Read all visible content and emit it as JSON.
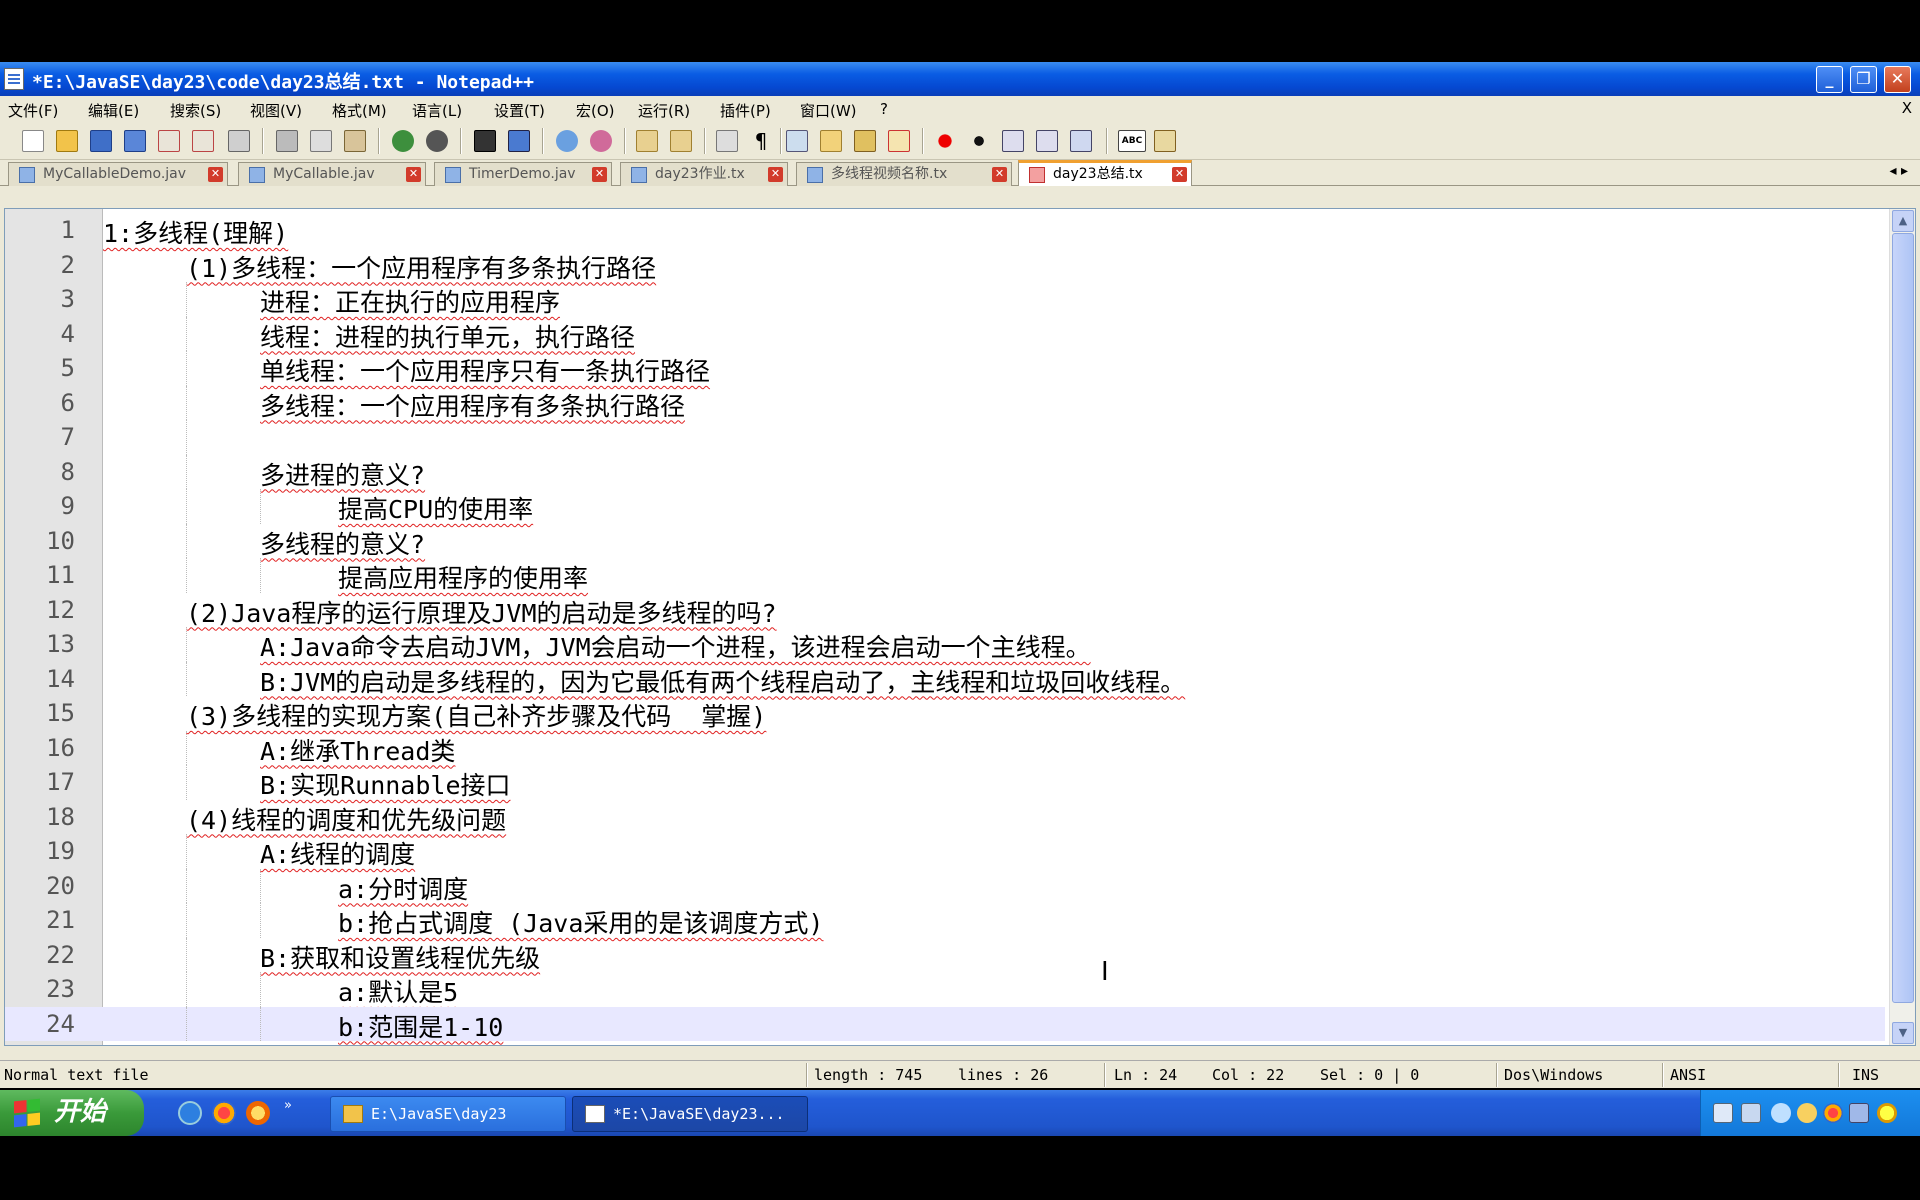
{
  "window": {
    "title": "*E:\\JavaSE\\day23\\code\\day23总结.txt - Notepad++"
  },
  "menu": [
    "文件(F)",
    "编辑(E)",
    "搜索(S)",
    "视图(V)",
    "格式(M)",
    "语言(L)",
    "设置(T)",
    "宏(O)",
    "运行(R)",
    "插件(P)",
    "窗口(W)",
    "?"
  ],
  "menu_close": "X",
  "tabs": [
    {
      "label": "MyCallableDemo.jav",
      "active": false
    },
    {
      "label": "MyCallable.jav",
      "active": false
    },
    {
      "label": "TimerDemo.jav",
      "active": false
    },
    {
      "label": "day23作业.tx",
      "active": false
    },
    {
      "label": "多线程视频名称.tx",
      "active": false
    },
    {
      "label": "day23总结.tx",
      "active": true
    }
  ],
  "tab_arrows": "◂ ▸",
  "editor": {
    "current_line": 24,
    "lines": [
      {
        "n": "1",
        "indent": 0,
        "text": "1:多线程(理解)"
      },
      {
        "n": "2",
        "indent": 1,
        "text": "(1)多线程：一个应用程序有多条执行路径"
      },
      {
        "n": "3",
        "indent": 2,
        "text": "进程：正在执行的应用程序"
      },
      {
        "n": "4",
        "indent": 2,
        "text": "线程：进程的执行单元，执行路径"
      },
      {
        "n": "5",
        "indent": 2,
        "text": "单线程：一个应用程序只有一条执行路径"
      },
      {
        "n": "6",
        "indent": 2,
        "text": "多线程：一个应用程序有多条执行路径"
      },
      {
        "n": "7",
        "indent": 2,
        "text": ""
      },
      {
        "n": "8",
        "indent": 2,
        "text": "多进程的意义?"
      },
      {
        "n": "9",
        "indent": 3,
        "text": "提高CPU的使用率"
      },
      {
        "n": "10",
        "indent": 2,
        "text": "多线程的意义?"
      },
      {
        "n": "11",
        "indent": 3,
        "text": "提高应用程序的使用率"
      },
      {
        "n": "12",
        "indent": 1,
        "text": "(2)Java程序的运行原理及JVM的启动是多线程的吗?"
      },
      {
        "n": "13",
        "indent": 2,
        "text": "A:Java命令去启动JVM，JVM会启动一个进程，该进程会启动一个主线程。"
      },
      {
        "n": "14",
        "indent": 2,
        "text": "B:JVM的启动是多线程的，因为它最低有两个线程启动了，主线程和垃圾回收线程。"
      },
      {
        "n": "15",
        "indent": 1,
        "text": "(3)多线程的实现方案(自己补齐步骤及代码  掌握)"
      },
      {
        "n": "16",
        "indent": 2,
        "text": "A:继承Thread类"
      },
      {
        "n": "17",
        "indent": 2,
        "text": "B:实现Runnable接口"
      },
      {
        "n": "18",
        "indent": 1,
        "text": "(4)线程的调度和优先级问题"
      },
      {
        "n": "19",
        "indent": 2,
        "text": "A:线程的调度"
      },
      {
        "n": "20",
        "indent": 3,
        "text": "a:分时调度"
      },
      {
        "n": "21",
        "indent": 3,
        "text": "b:抢占式调度 (Java采用的是该调度方式)"
      },
      {
        "n": "22",
        "indent": 2,
        "text": "B:获取和设置线程优先级"
      },
      {
        "n": "23",
        "indent": 3,
        "text": "a:默认是5"
      },
      {
        "n": "24",
        "indent": 3,
        "text": "b:范围是1-10"
      }
    ]
  },
  "status": {
    "file_type": "Normal text file",
    "length": "length : 745",
    "lines": "lines : 26",
    "ln": "Ln : 24",
    "col": "Col : 22",
    "sel": "Sel : 0 | 0",
    "eol": "Dos\\Windows",
    "encoding": "ANSI",
    "mode": "INS"
  },
  "taskbar": {
    "start_label": "开始",
    "tasks": [
      {
        "label": "E:\\JavaSE\\day23",
        "active": false
      },
      {
        "label": "*E:\\JavaSE\\day23...",
        "active": true
      }
    ]
  }
}
